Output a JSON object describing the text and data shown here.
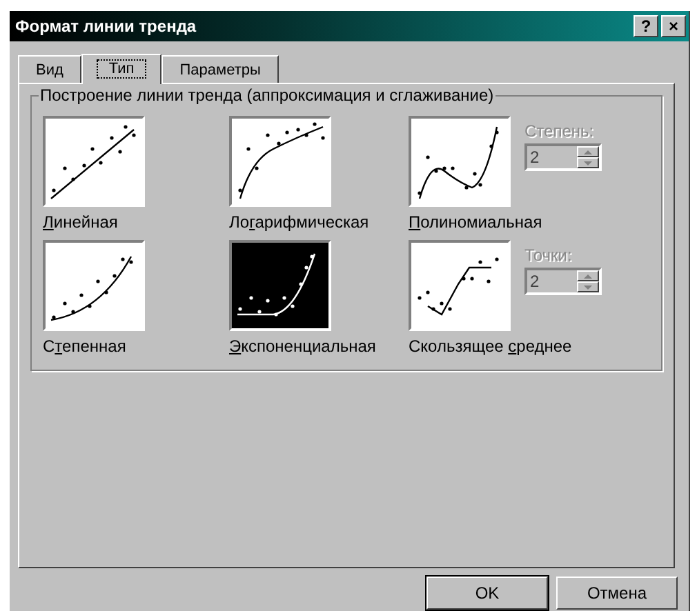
{
  "window": {
    "title": "Формат линии тренда",
    "help_button": "?",
    "close_button": "×"
  },
  "tabs": [
    {
      "label": "Вид",
      "selected": false
    },
    {
      "label": "Тип",
      "selected": true
    },
    {
      "label": "Параметры",
      "selected": false
    }
  ],
  "group": {
    "title": "Построение линии тренда (аппроксимация и сглаживание)"
  },
  "types": [
    {
      "kind": "linear",
      "mnemonic": "Л",
      "post": "инейная",
      "selected": false
    },
    {
      "kind": "log",
      "pre": "Ло",
      "mnemonic": "г",
      "post": "арифмическая",
      "selected": false
    },
    {
      "kind": "poly",
      "mnemonic": "П",
      "post": "олиномиальная",
      "selected": false,
      "spin": {
        "label": "Степень:",
        "value": "2",
        "disabled": true
      }
    },
    {
      "kind": "power",
      "pre": "С",
      "mnemonic": "т",
      "post": "епенная",
      "selected": false
    },
    {
      "kind": "exp",
      "mnemonic": "Э",
      "post": "кспоненциальная",
      "selected": true
    },
    {
      "kind": "moving",
      "pre": "Скользящее ",
      "mnemonic": "с",
      "post": "реднее",
      "selected": false,
      "spin": {
        "label": "Точки:",
        "value": "2",
        "disabled": true
      }
    }
  ],
  "buttons": [
    {
      "label": "OK",
      "default": true
    },
    {
      "label": "Отмена",
      "default": false
    }
  ]
}
